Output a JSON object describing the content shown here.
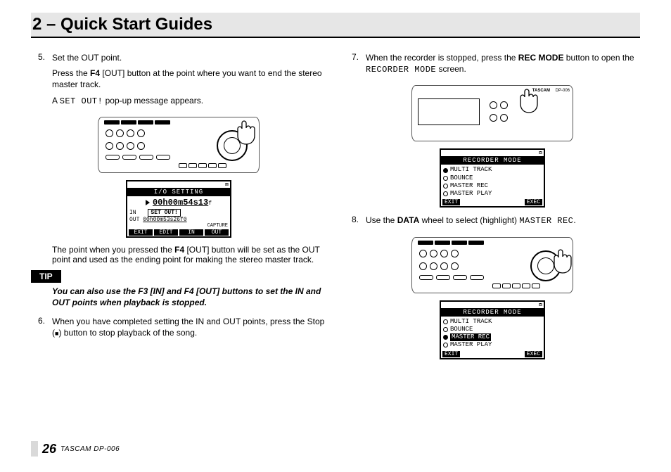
{
  "header": {
    "title": "2 – Quick Start Guides"
  },
  "left": {
    "step5": {
      "num": "5.",
      "line1": "Set the OUT point.",
      "line2a": "Press the ",
      "line2b": "F4",
      "line2c": " [OUT] button at the point where you want to end the stereo master track.",
      "line3a": "A ",
      "line3b": "SET OUT!",
      "line3c": " pop-up message appears."
    },
    "lcd_io": {
      "title": "I/O SETTING",
      "status": "⧈",
      "time_main": "00h00m54s13",
      "time_sub": "f",
      "in_prefix": "IN",
      "out_prefix": "OUT",
      "callout": "SET OUT!",
      "out_time": "00h00m53s26f0",
      "capture": "CAPTURE",
      "fn1": "EXIT",
      "fn2": "EDIT",
      "fn3": "IN",
      "fn4": "OUT"
    },
    "step5_post": {
      "text_a": "The point when you pressed the ",
      "text_b": "F4",
      "text_c": " [OUT] button will be set as the OUT point and used as the ending point for making the stereo master track."
    },
    "tip": {
      "label": "TIP",
      "body_a": "You can also use the ",
      "body_b": "F3",
      "body_c": " [IN] and ",
      "body_d": "F4",
      "body_e": " [OUT] buttons to set the IN and OUT points when playback is stopped."
    },
    "step6": {
      "num": "6.",
      "text_a": "When you have completed setting the IN and OUT points, press the Stop (",
      "stop_icon": "■",
      "text_b": ") button to stop playback of the song."
    }
  },
  "right": {
    "step7": {
      "num": "7.",
      "text_a": "When the recorder is stopped, press the ",
      "text_b": "REC MODE",
      "text_c": " button to open the ",
      "text_d": "RECORDER MODE",
      "text_e": " screen."
    },
    "device_brand": "TASCAM",
    "device_model": "DP-006",
    "lcd1": {
      "title": "RECORDER MODE",
      "status": "⧈",
      "opts": [
        "MULTI TRACK",
        "BOUNCE",
        "MASTER REC",
        "MASTER PLAY"
      ],
      "selected_index": 0,
      "fn_l": "EXIT",
      "fn_r": "EXEC"
    },
    "step8": {
      "num": "8.",
      "text_a": "Use the ",
      "text_b": "DATA",
      "text_c": " wheel to select (highlight) ",
      "text_d": "MASTER REC",
      "text_e": "."
    },
    "lcd2": {
      "title": "RECORDER MODE",
      "status": "⧈",
      "opts": [
        "MULTI TRACK",
        "BOUNCE",
        "MASTER REC",
        "MASTER PLAY"
      ],
      "selected_index": 2,
      "fn_l": "EXIT",
      "fn_r": "EXEC"
    }
  },
  "footer": {
    "page": "26",
    "product": "TASCAM  DP-006"
  }
}
